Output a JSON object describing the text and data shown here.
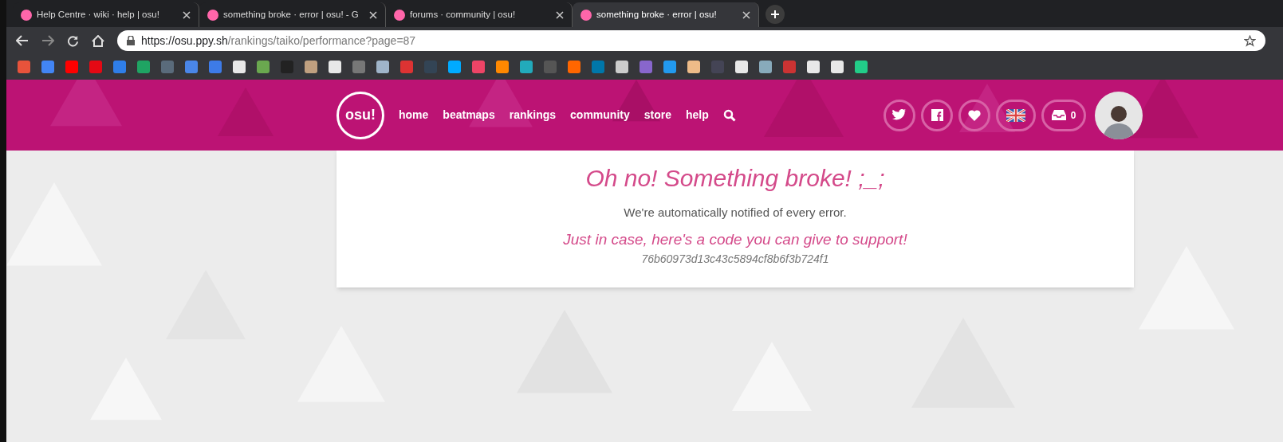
{
  "browser": {
    "tabs": [
      {
        "title": "Help Centre · wiki · help | osu!",
        "selected": false
      },
      {
        "title": "something broke · error | osu! - G",
        "selected": false
      },
      {
        "title": "forums · community | osu!",
        "selected": false
      },
      {
        "title": "something broke · error | osu!",
        "selected": true
      }
    ],
    "address": {
      "host": "https://osu.ppy.sh",
      "path": "/rankings/taiko/performance?page=87"
    }
  },
  "header": {
    "logo": "osu!",
    "nav": [
      "home",
      "beatmaps",
      "rankings",
      "community",
      "store",
      "help"
    ],
    "notification_count": "0"
  },
  "error": {
    "title": "Oh no! Something broke! ;_;",
    "message": "We're automatically notified of every error.",
    "support": "Just in case, here's a code you can give to support!",
    "code": "76b60973d13c43c5894cf8b6f3b724f1"
  }
}
